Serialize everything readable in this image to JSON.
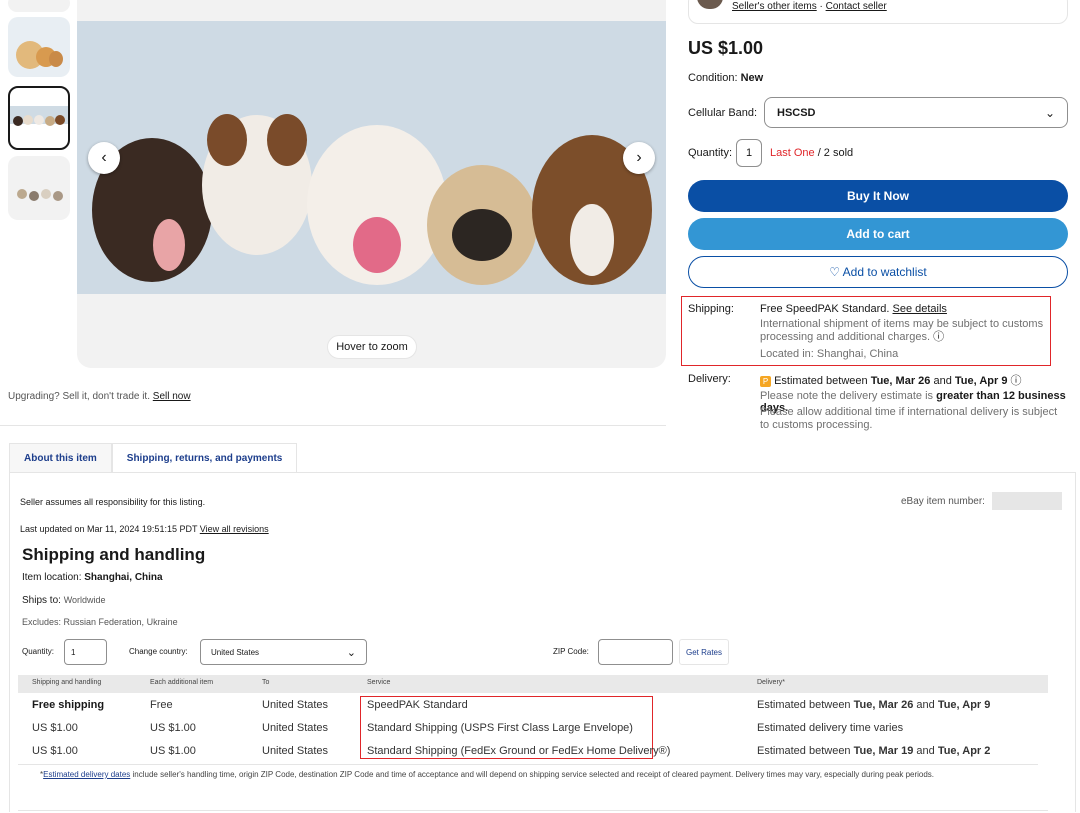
{
  "seller": {
    "other_items": "Seller's other items",
    "separator": " · ",
    "contact": "Contact seller"
  },
  "listing": {
    "price": "US $1.00",
    "condition_label": "Condition:",
    "condition_value": "New",
    "band_label": "Cellular Band:",
    "band_value": "HSCSD",
    "quantity_label": "Quantity:",
    "quantity_value": "1",
    "last_one": "Last One",
    "sold": " / 2 sold",
    "buy_now": "Buy It Now",
    "add_cart": "Add to cart",
    "watchlist": "♡ Add to watchlist"
  },
  "shipping_summary": {
    "label": "Shipping:",
    "service": "Free SpeedPAK Standard.",
    "see_details": "See details",
    "note": "International shipment of items may be subject to customs processing and additional charges.",
    "location": "Located in: Shanghai, China"
  },
  "delivery_summary": {
    "label": "Delivery:",
    "badge": "P",
    "est_prefix": "Estimated between ",
    "est_start": "Tue, Mar 26",
    "est_mid": " and ",
    "est_end": "Tue, Apr 9",
    "note_prefix": "Please note the delivery estimate is ",
    "note_bold": "greater than 12 business days.",
    "note2": "Please allow additional time if international delivery is subject to customs processing."
  },
  "image": {
    "hover_zoom": "Hover to zoom"
  },
  "upgrade": {
    "text": "Upgrading? Sell it, don't trade it. ",
    "link": "Sell now"
  },
  "tabs": [
    {
      "label": "About this item"
    },
    {
      "label": "Shipping, returns, and payments"
    }
  ],
  "details": {
    "responsibility": "Seller assumes all responsibility for this listing.",
    "item_number_label": "eBay item number:",
    "updated": "Last updated on Mar 11, 2024 19:51:15 PDT ",
    "revisions": "View all revisions",
    "heading": "Shipping and handling",
    "location_label": "Item location: ",
    "location_value": "Shanghai, China",
    "ships_label": "Ships to: ",
    "ships_value": "Worldwide",
    "excludes": "Excludes: Russian Federation, Ukraine",
    "qty_label": "Quantity:",
    "qty_value": "1",
    "country_label": "Change country:",
    "country_value": "United States",
    "zip_label": "ZIP Code:",
    "get_rates": "Get Rates"
  },
  "table": {
    "headers": [
      "Shipping and handling",
      "Each additional item",
      "To",
      "Service",
      "Delivery*"
    ],
    "rows": [
      {
        "cost": "Free shipping",
        "each": "Free",
        "to": "United States",
        "service": "SpeedPAK Standard",
        "d1": "Estimated between ",
        "d2": "Tue, Mar 26",
        "d3": " and ",
        "d4": "Tue, Apr 9"
      },
      {
        "cost": "US $1.00",
        "each": "US $1.00",
        "to": "United States",
        "service": "Standard Shipping (USPS First Class Large Envelope)",
        "d1": "Estimated delivery time varies",
        "d2": "",
        "d3": "",
        "d4": ""
      },
      {
        "cost": "US $1.00",
        "each": "US $1.00",
        "to": "United States",
        "service": "Standard Shipping (FedEx Ground or FedEx Home Delivery®)",
        "d1": "Estimated between ",
        "d2": "Tue, Mar 19",
        "d3": " and ",
        "d4": "Tue, Apr 2"
      }
    ],
    "footnote_link": "Estimated delivery dates",
    "footnote_text": " include seller's handling time, origin ZIP Code, destination ZIP Code and time of acceptance and will depend on shipping service selected and receipt of cleared payment. Delivery times may vary, especially during peak periods."
  },
  "colors": {
    "buy_now": "#0a4fa5",
    "add_cart": "#3396d4",
    "accent_red": "#e0262a",
    "link_blue": "#1d3e8c",
    "badge_orange": "#f5a623"
  }
}
